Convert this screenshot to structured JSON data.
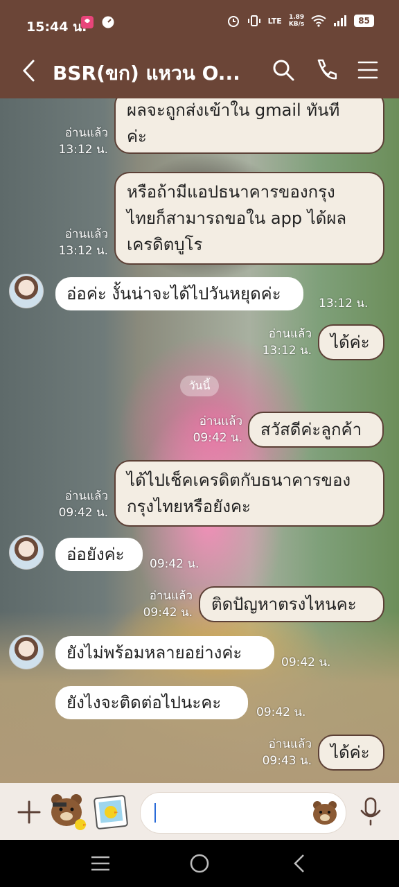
{
  "status_bar": {
    "time": "15:44 น.",
    "net_speed_value": "1.89",
    "net_speed_unit": "KB/s",
    "network": "LTE",
    "battery": "85"
  },
  "header": {
    "title": "BSR(ขก) แหวน O...",
    "color": "#6b4537"
  },
  "chat": {
    "date_separator": "วันนี้",
    "messages": [
      {
        "id": "m1",
        "direction": "out",
        "lines": [
          "ผลจะถูกส่งเข้าใน gmail ทันที",
          "ค่ะ"
        ],
        "read": "อ่านแล้ว",
        "time": "13:12 น."
      },
      {
        "id": "m2",
        "direction": "out",
        "lines": [
          "หรือถ้ามีแอปธนาคารของกรุง",
          "ไทยก็สามารถขอใน app ได้ผล",
          "เครดิตบูโร"
        ],
        "read": "อ่านแล้ว",
        "time": "13:12 น."
      },
      {
        "id": "m3",
        "direction": "in",
        "lines": [
          "อ่อค่ะ งั้นน่าจะได้ไปวันหยุดค่ะ"
        ],
        "time": "13:12 น."
      },
      {
        "id": "m4",
        "direction": "out",
        "lines": [
          "ได้ค่ะ"
        ],
        "read": "อ่านแล้ว",
        "time": "13:12 น."
      },
      {
        "id": "m5",
        "direction": "out",
        "lines": [
          "สวัสดีค่ะลูกค้า"
        ],
        "read": "อ่านแล้ว",
        "time": "09:42 น."
      },
      {
        "id": "m6",
        "direction": "out",
        "lines": [
          "ได้ไปเช็คเครดิตกับธนาคารของ",
          "กรุงไทยหรือยังคะ"
        ],
        "read": "อ่านแล้ว",
        "time": "09:42 น."
      },
      {
        "id": "m7",
        "direction": "in",
        "lines": [
          "อ่อยังค่ะ"
        ],
        "time": "09:42 น."
      },
      {
        "id": "m8",
        "direction": "out",
        "lines": [
          "ติดปัญหาตรงไหนคะ"
        ],
        "read": "อ่านแล้ว",
        "time": "09:42 น."
      },
      {
        "id": "m9",
        "direction": "in",
        "lines": [
          "ยังไม่พร้อมหลายอย่างค่ะ"
        ],
        "time": "09:42 น."
      },
      {
        "id": "m10",
        "direction": "in",
        "lines": [
          "ยังไงจะติดต่อไปนะคะ"
        ],
        "time": "09:42 น."
      },
      {
        "id": "m11",
        "direction": "out",
        "lines": [
          "ได้ค่ะ"
        ],
        "read": "อ่านแล้ว",
        "time": "09:43 น."
      }
    ]
  },
  "input": {
    "placeholder": ""
  },
  "icons": {
    "back": "chevron-left-icon",
    "search": "search-icon",
    "call": "phone-icon",
    "menu": "hamburger-menu-icon",
    "plus": "plus-icon",
    "sticker_bear": "brown-bear-sticker-icon",
    "sticker_album": "photo-album-icon",
    "emoji": "bear-emoji-icon",
    "mic": "microphone-icon"
  }
}
